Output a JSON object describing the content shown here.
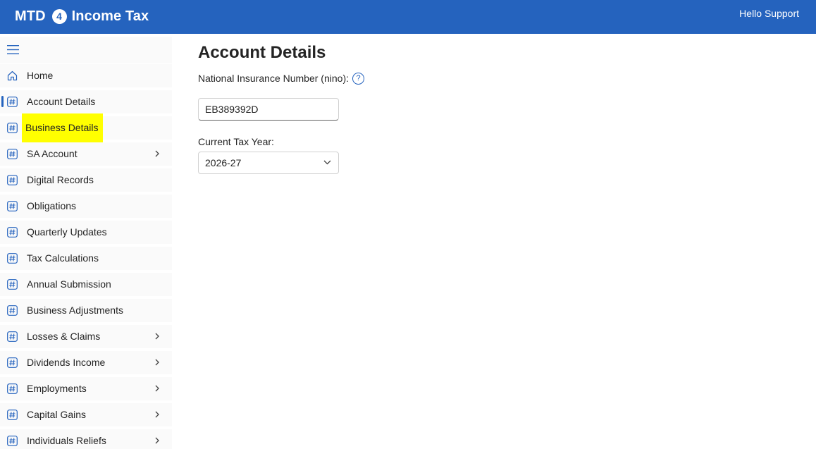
{
  "app": {
    "title_left": "MTD",
    "title_badge": "4",
    "title_right": "Income Tax",
    "greeting": "Hello Support"
  },
  "colors": {
    "brand_blue": "#2563be",
    "highlight_yellow": "#ffff00"
  },
  "sidebar": {
    "toggle_icon": "hamburger-icon",
    "items": [
      {
        "label": "Home",
        "icon": "home-icon",
        "expandable": false,
        "active": false,
        "highlighted": false
      },
      {
        "label": "Account Details",
        "icon": "hash-icon",
        "expandable": false,
        "active": true,
        "highlighted": false
      },
      {
        "label": "Business Details",
        "icon": "hash-icon",
        "expandable": false,
        "active": false,
        "highlighted": true
      },
      {
        "label": "SA Account",
        "icon": "hash-icon",
        "expandable": true,
        "active": false,
        "highlighted": false
      },
      {
        "label": "Digital Records",
        "icon": "hash-icon",
        "expandable": false,
        "active": false,
        "highlighted": false
      },
      {
        "label": "Obligations",
        "icon": "hash-icon",
        "expandable": false,
        "active": false,
        "highlighted": false
      },
      {
        "label": "Quarterly Updates",
        "icon": "hash-icon",
        "expandable": false,
        "active": false,
        "highlighted": false
      },
      {
        "label": "Tax Calculations",
        "icon": "hash-icon",
        "expandable": false,
        "active": false,
        "highlighted": false
      },
      {
        "label": "Annual Submission",
        "icon": "hash-icon",
        "expandable": false,
        "active": false,
        "highlighted": false
      },
      {
        "label": "Business Adjustments",
        "icon": "hash-icon",
        "expandable": false,
        "active": false,
        "highlighted": false
      },
      {
        "label": "Losses & Claims",
        "icon": "hash-icon",
        "expandable": true,
        "active": false,
        "highlighted": false
      },
      {
        "label": "Dividends Income",
        "icon": "hash-icon",
        "expandable": true,
        "active": false,
        "highlighted": false
      },
      {
        "label": "Employments",
        "icon": "hash-icon",
        "expandable": true,
        "active": false,
        "highlighted": false
      },
      {
        "label": "Capital Gains",
        "icon": "hash-icon",
        "expandable": true,
        "active": false,
        "highlighted": false
      },
      {
        "label": "Individuals Reliefs",
        "icon": "hash-icon",
        "expandable": true,
        "active": false,
        "highlighted": false
      }
    ]
  },
  "main": {
    "page_title": "Account Details",
    "nino_label": "National Insurance Number (nino):",
    "help_icon_glyph": "?",
    "nino_value": "EB389392D",
    "tax_year_label": "Current Tax Year:",
    "tax_year_value": "2026-27"
  }
}
